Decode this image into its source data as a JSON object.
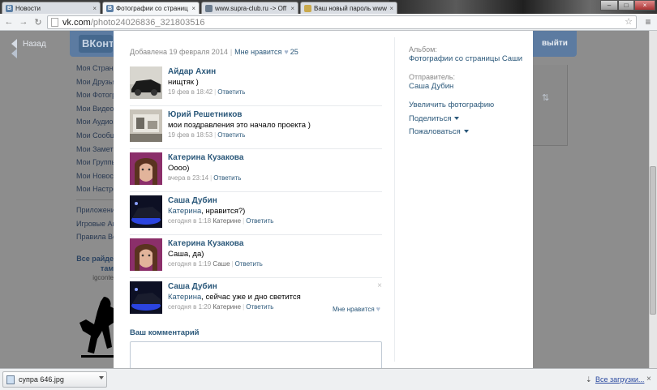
{
  "browser": {
    "tabs": [
      {
        "label": "Новости",
        "icon": "vk-favicon",
        "close": "×",
        "active": false
      },
      {
        "label": "Фотографии со страниц",
        "icon": "vk-favicon",
        "close": "×",
        "active": true
      },
      {
        "label": "www.supra-club.ru -> Off",
        "icon": "supra-favicon",
        "close": "×",
        "active": false
      },
      {
        "label": "Ваш новый пароль www.",
        "icon": "mail-favicon",
        "close": "×",
        "active": false
      }
    ],
    "window_controls": {
      "minimize": "–",
      "maximize": "□",
      "close": "×"
    },
    "url_host": "vk.com",
    "url_path": "/photo24026836_321803516",
    "icons": {
      "back": "back-arrow-icon",
      "forward": "forward-arrow-icon",
      "reload": "reload-icon",
      "star": "star-icon",
      "menu": "wrench-icon"
    }
  },
  "page": {
    "back_label": "Назад",
    "logo_text": "ВКонтакте",
    "logout_label": "выйти",
    "side_menu": [
      "Моя Страница",
      "Мои Друзья",
      "Мои Фотографии",
      "Мои Видеозаписи",
      "Мои Аудиозаписи",
      "Мои Сообщения",
      "Мои Заметки",
      "Мои Группы",
      "Мои Новости",
      "Мои Настройки"
    ],
    "side_menu_extra": [
      "Приложения",
      "Игровые Автоматы",
      "Правила Во"
    ],
    "promo": {
      "title_line1": "Все райде",
      "title_line2": "там",
      "subtitle": "igconte"
    }
  },
  "photo_viewer": {
    "added_date": "Добавлена 19 февраля 2014",
    "like_label": "Мне нравится",
    "like_count": "25",
    "comments": [
      {
        "author": "Айдар Ахин",
        "text": "нищтяк )",
        "time": "19 фев в 18:42",
        "reply_label": "Ответить",
        "avatar": "car-dark"
      },
      {
        "author": "Юрий Решетников",
        "text": "мои поздравления это начало проекта )",
        "time": "19 фев в 18:53",
        "reply_label": "Ответить",
        "avatar": "garage"
      },
      {
        "author": "Катерина Кузакова",
        "text": "Оооо)",
        "time": "вчера в 23:14",
        "reply_label": "Ответить",
        "avatar": "girl"
      },
      {
        "author": "Саша Дубин",
        "reply_to": "Катерина",
        "text": ", нравится?)",
        "time": "сегодня в 1:18",
        "reply_target": "Катерине",
        "reply_label": "Ответить",
        "avatar": "car-blue"
      },
      {
        "author": "Катерина Кузакова",
        "text": "Саша, да)",
        "time": "сегодня в 1:19",
        "reply_target": "Саше",
        "reply_label": "Ответить",
        "avatar": "girl"
      },
      {
        "author": "Саша Дубин",
        "reply_to": "Катерина",
        "text": ", сейчас уже и дно светится",
        "time": "сегодня в 1:20",
        "reply_target": "Катерине",
        "reply_label": "Ответить",
        "avatar": "car-blue",
        "like_label": "Мне нравится",
        "close": "×"
      }
    ],
    "your_comment_label": "Ваш комментарий",
    "album_label": "Альбом:",
    "album_name": "Фотографии со страницы Саши",
    "sender_label": "Отправитель:",
    "sender_name": "Саша Дубин",
    "actions": [
      "Увеличить фотографию",
      "Поделиться",
      "Пожаловаться"
    ]
  },
  "download_bar": {
    "file_name": "супра 646.jpg",
    "all_downloads_label": "Все загрузки...",
    "close": "×"
  },
  "colors": {
    "vk_header": "#5c7ba1",
    "link": "#2b587a",
    "overlay": "#8d8d8d"
  }
}
